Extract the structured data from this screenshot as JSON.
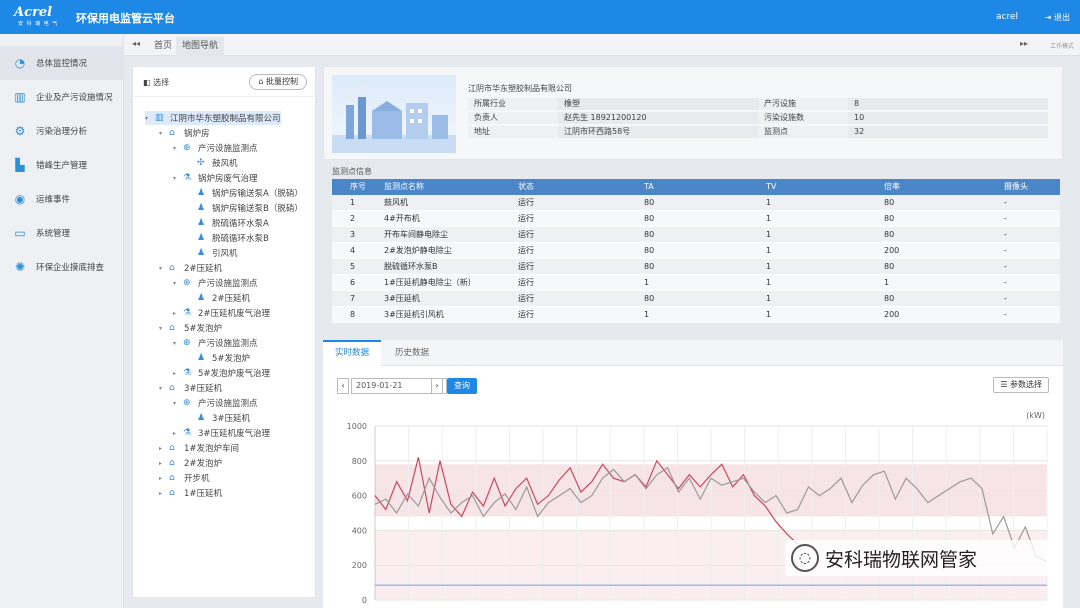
{
  "header": {
    "logo": "Acrel",
    "logo_sub": "安 科 瑞 电 气",
    "title": "环保用电监管云平台",
    "user": "acrel",
    "logout": "退出"
  },
  "sidebar": {
    "items": [
      {
        "label": "总体监控情况",
        "icon": "dashboard-icon",
        "active": true
      },
      {
        "label": "企业及产污设施情况",
        "icon": "building-icon"
      },
      {
        "label": "污染治理分析",
        "icon": "gear-icon"
      },
      {
        "label": "错峰生产管理",
        "icon": "factory-icon"
      },
      {
        "label": "运维事件",
        "icon": "wifi-icon"
      },
      {
        "label": "系统管理",
        "icon": "monitor-icon"
      },
      {
        "label": "环保企业摸底排查",
        "icon": "settings-icon"
      }
    ]
  },
  "tabbar": {
    "tabs": [
      "首页",
      "地图导航"
    ],
    "right_text": "工作模式"
  },
  "tree": {
    "select_label": "选择",
    "batch_button": "批量控制",
    "nodes": [
      {
        "t": "江阴市华东塑胶制品有限公司",
        "l": 0,
        "i": "building",
        "e": "▾",
        "s": true
      },
      {
        "t": "锅炉房",
        "l": 1,
        "i": "home",
        "e": "▾"
      },
      {
        "t": "产污设施监测点",
        "l": 2,
        "i": "target",
        "e": "▾"
      },
      {
        "t": "鼓风机",
        "l": 3,
        "i": "fan",
        "e": ""
      },
      {
        "t": "锅炉房废气治理",
        "l": 2,
        "i": "flask",
        "e": "▾"
      },
      {
        "t": "锅炉房输送泵A（脱硝）",
        "l": 3,
        "i": "pump",
        "e": ""
      },
      {
        "t": "锅炉房输送泵B（脱硝）",
        "l": 3,
        "i": "pump",
        "e": ""
      },
      {
        "t": "脱硫循环水泵A",
        "l": 3,
        "i": "pump",
        "e": ""
      },
      {
        "t": "脱硫循环水泵B",
        "l": 3,
        "i": "pump",
        "e": ""
      },
      {
        "t": "引风机",
        "l": 3,
        "i": "pump",
        "e": ""
      },
      {
        "t": "2#压延机",
        "l": 1,
        "i": "home",
        "e": "▾"
      },
      {
        "t": "产污设施监测点",
        "l": 2,
        "i": "target",
        "e": "▾"
      },
      {
        "t": "2#压延机",
        "l": 3,
        "i": "pump",
        "e": ""
      },
      {
        "t": "2#压延机废气治理",
        "l": 2,
        "i": "flask",
        "e": "▸"
      },
      {
        "t": "5#发泡炉",
        "l": 1,
        "i": "home",
        "e": "▾"
      },
      {
        "t": "产污设施监测点",
        "l": 2,
        "i": "target",
        "e": "▾"
      },
      {
        "t": "5#发泡炉",
        "l": 3,
        "i": "pump",
        "e": ""
      },
      {
        "t": "5#发泡炉废气治理",
        "l": 2,
        "i": "flask",
        "e": "▸"
      },
      {
        "t": "3#压延机",
        "l": 1,
        "i": "home",
        "e": "▾"
      },
      {
        "t": "产污设施监测点",
        "l": 2,
        "i": "target",
        "e": "▾"
      },
      {
        "t": "3#压延机",
        "l": 3,
        "i": "pump",
        "e": ""
      },
      {
        "t": "3#压延机废气治理",
        "l": 2,
        "i": "flask",
        "e": "▸"
      },
      {
        "t": "1#发泡炉车间",
        "l": 1,
        "i": "home",
        "e": "▸"
      },
      {
        "t": "2#发泡炉",
        "l": 1,
        "i": "home",
        "e": "▸"
      },
      {
        "t": "开步机",
        "l": 1,
        "i": "home",
        "e": "▸"
      },
      {
        "t": "1#压延机",
        "l": 1,
        "i": "home",
        "e": "▸"
      }
    ]
  },
  "company": {
    "name": "江阴市华东塑胶制品有限公司",
    "rows": [
      [
        "所属行业",
        "橡塑",
        "产污设施",
        "8"
      ],
      [
        "负责人",
        "赵先生 18921200120",
        "污染设施数",
        "10"
      ],
      [
        "地址",
        "江阴市环西路58号",
        "监测点",
        "32"
      ]
    ]
  },
  "monitor": {
    "title": "监测点信息",
    "columns": [
      "序号",
      "监测点名称",
      "状态",
      "TA",
      "TV",
      "倍率",
      "摄像头"
    ],
    "rows": [
      [
        "1",
        "鼓风机",
        "运行",
        "80",
        "1",
        "80",
        "-"
      ],
      [
        "2",
        "4#开布机",
        "运行",
        "80",
        "1",
        "80",
        "-"
      ],
      [
        "3",
        "开布车间静电除尘",
        "运行",
        "80",
        "1",
        "80",
        "-"
      ],
      [
        "4",
        "2#发泡炉静电除尘",
        "运行",
        "80",
        "1",
        "200",
        "-"
      ],
      [
        "5",
        "脱硫循环水泵B",
        "运行",
        "80",
        "1",
        "80",
        "-"
      ],
      [
        "6",
        "1#压延机静电除尘（新）",
        "运行",
        "1",
        "1",
        "1",
        "-"
      ],
      [
        "7",
        "3#压延机",
        "运行",
        "80",
        "1",
        "80",
        "-"
      ],
      [
        "8",
        "3#压延机引风机",
        "运行",
        "1",
        "1",
        "200",
        "-"
      ]
    ]
  },
  "data_tabs": [
    "实时数据",
    "历史数据"
  ],
  "query": {
    "prev": "‹",
    "next": "›",
    "date": "2019-01-21",
    "button": "查询",
    "params": "参数选择"
  },
  "chart_data": {
    "type": "line",
    "ylabel": "(kW)",
    "ylim": [
      0,
      1000
    ],
    "yticks": [
      0,
      200,
      400,
      600,
      800,
      1000
    ],
    "bands": [
      [
        480,
        780
      ],
      [
        0,
        400
      ]
    ],
    "series": [
      {
        "color": "#c84a5e",
        "values": [
          600,
          520,
          680,
          570,
          820,
          500,
          800,
          550,
          480,
          620,
          540,
          700,
          540,
          640,
          700,
          550,
          600,
          690,
          760,
          620,
          680,
          780,
          700,
          680,
          720,
          650,
          800,
          720,
          640,
          720,
          650,
          720,
          780,
          650,
          720,
          600,
          540,
          450,
          380,
          320
        ]
      },
      {
        "color": "#9a9a9a",
        "values": [
          550,
          580,
          500,
          610,
          540,
          700,
          590,
          500,
          560,
          600,
          480,
          560,
          610,
          520,
          650,
          480,
          560,
          600,
          640,
          560,
          600,
          700,
          750,
          680,
          720,
          640,
          720,
          760,
          620,
          700,
          580,
          700,
          660,
          680,
          700,
          620,
          560,
          600,
          500,
          520,
          650,
          600,
          640,
          700,
          560,
          660,
          720,
          740,
          580,
          700,
          640,
          560,
          600,
          640,
          680,
          700,
          640,
          380,
          480,
          300,
          420,
          250,
          220
        ]
      },
      {
        "color": "#7fa9df",
        "values": [
          85,
          85,
          85,
          85,
          85,
          85,
          85,
          85,
          85,
          85,
          85,
          85,
          85,
          85,
          85,
          85,
          85,
          85,
          85,
          85,
          85,
          85,
          85,
          85,
          85,
          85,
          85,
          85,
          85,
          85,
          85,
          85,
          85,
          85,
          85,
          85,
          85,
          85,
          85,
          85,
          85,
          85,
          85,
          85,
          85,
          85,
          85,
          85,
          85,
          85,
          85,
          85,
          85,
          85,
          85,
          85,
          85,
          85,
          85,
          85,
          85,
          85,
          85
        ]
      }
    ]
  },
  "watermark": "安科瑞物联网管家"
}
